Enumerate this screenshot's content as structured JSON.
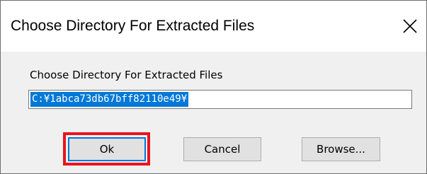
{
  "dialog": {
    "title": "Choose Directory For Extracted Files",
    "close_icon": "close-icon"
  },
  "form": {
    "prompt": "Choose Directory For Extracted Files",
    "path_value": "C:¥1abca73db67bff82110e49¥"
  },
  "buttons": {
    "ok": "Ok",
    "cancel": "Cancel",
    "browse": "Browse..."
  },
  "colors": {
    "selection": "#0078d7",
    "highlight": "#e8141e"
  }
}
